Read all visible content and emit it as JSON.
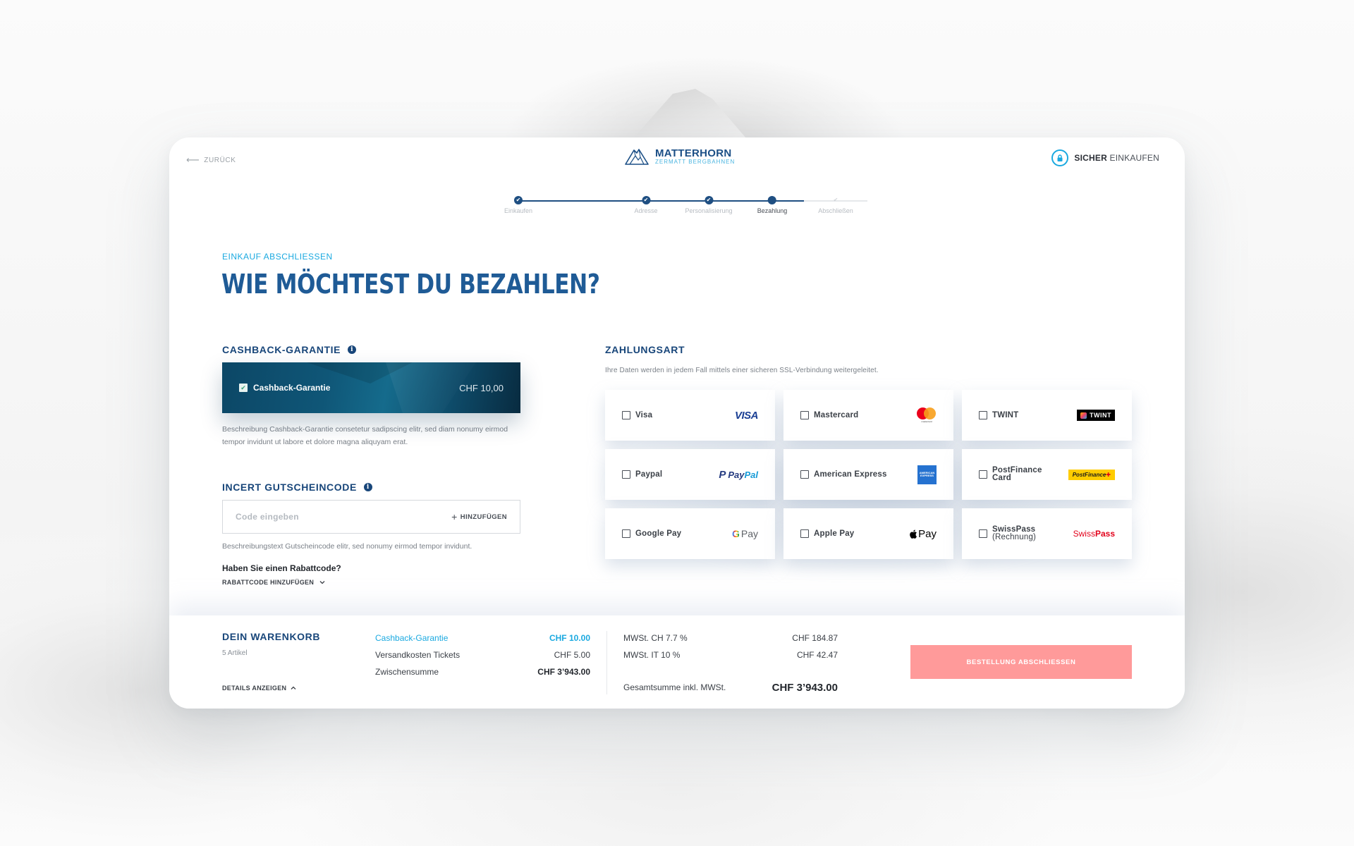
{
  "header": {
    "back_label": "ZURÜCK",
    "logo": {
      "name": "MATTERHORN",
      "subtitle": "ZERMATT BERGBAHNEN"
    },
    "secure": {
      "bold": "SICHER",
      "rest": "EINKAUFEN"
    }
  },
  "stepper": {
    "steps": [
      {
        "label": "Einkaufen",
        "state": "done"
      },
      {
        "label": "Adresse",
        "state": "done"
      },
      {
        "label": "Personalisierung",
        "state": "done"
      },
      {
        "label": "Bezahlung",
        "state": "active"
      },
      {
        "label": "Abschließen",
        "state": "pending"
      }
    ],
    "check_glyph": "✔"
  },
  "page": {
    "eyebrow": "EINKAUF ABSCHLIESSEN",
    "title": "WIE MÖCHTEST DU BEZAHLEN?"
  },
  "cashback": {
    "heading": "CASHBACK-GARANTIE",
    "info_glyph": "i",
    "option_label": "Cashback-Garantie",
    "checked": true,
    "check_glyph": "✔",
    "price": "CHF 10,00",
    "description": "Beschreibung Cashback-Garantie consetetur sadipscing elitr, sed diam nonumy eirmod tempor invidunt ut labore et dolore magna aliquyam erat."
  },
  "voucher": {
    "heading": "INCERT GUTSCHEINCODE",
    "info_glyph": "i",
    "input_value": "",
    "input_placeholder": "Code eingeben",
    "add_plus": "+",
    "add_label": "HINZUFÜGEN",
    "description": "Beschreibungstext Gutscheincode elitr, sed nonumy eirmod tempor invidunt.",
    "rabatt_question": "Haben Sie einen Rabattcode?",
    "rabatt_link": "RABATTCODE HINZUFÜGEN",
    "rabatt_chevron": "⌄"
  },
  "payment": {
    "heading": "ZAHLUNGSART",
    "subtitle": "Ihre Daten werden in jedem Fall mittels einer sicheren SSL-Verbindung weitergeleitet.",
    "methods": [
      {
        "label": "Visa",
        "sub": "",
        "brand": "VISA"
      },
      {
        "label": "Mastercard",
        "sub": "",
        "brand": "mastercard"
      },
      {
        "label": "TWINT",
        "sub": "",
        "brand": "TWINT"
      },
      {
        "label": "Paypal",
        "sub": "",
        "brand_a": "Pay",
        "brand_b": "Pal",
        "brand_p": "P"
      },
      {
        "label": "American Express",
        "sub": "",
        "brand": "AMERICAN EXPRESS"
      },
      {
        "label": "PostFinance",
        "sub": "Card",
        "brand": "PostFinance",
        "brand_mark": "✚"
      },
      {
        "label": "Google Pay",
        "sub": "",
        "brand_g": "G",
        "brand": "Pay"
      },
      {
        "label": "Apple Pay",
        "sub": "",
        "brand_apple": "",
        "brand": "Pay"
      },
      {
        "label": "SwissPass",
        "sub": "(Rechnung)",
        "brand_a": "Swiss",
        "brand_b": "Pass"
      }
    ]
  },
  "cart": {
    "title": "DEIN WARENKORB",
    "count": "5 Artikel",
    "details_label": "DETAILS ANZEIGEN",
    "details_chevron": "⌃",
    "lines": [
      {
        "label": "Cashback-Garantie",
        "value": "CHF 10.00"
      },
      {
        "label": "Versandkosten Tickets",
        "value": "CHF 5.00"
      },
      {
        "label": "Zwischensumme",
        "value": "CHF 3’943.00"
      }
    ],
    "taxes": [
      {
        "label": "MWSt. CH 7.7 %",
        "value": "CHF 184.87"
      },
      {
        "label": "MWSt. IT 10 %",
        "value": "CHF 42.47"
      }
    ],
    "total": {
      "label": "Gesamtsumme inkl. MWSt.",
      "value": "CHF 3’943.00"
    },
    "order_button": "BESTELLUNG ABSCHLIESSEN"
  },
  "colors": {
    "primary": "#18467a",
    "accent": "#1aa9e0",
    "cta_disabled": "#ff9a9a"
  }
}
